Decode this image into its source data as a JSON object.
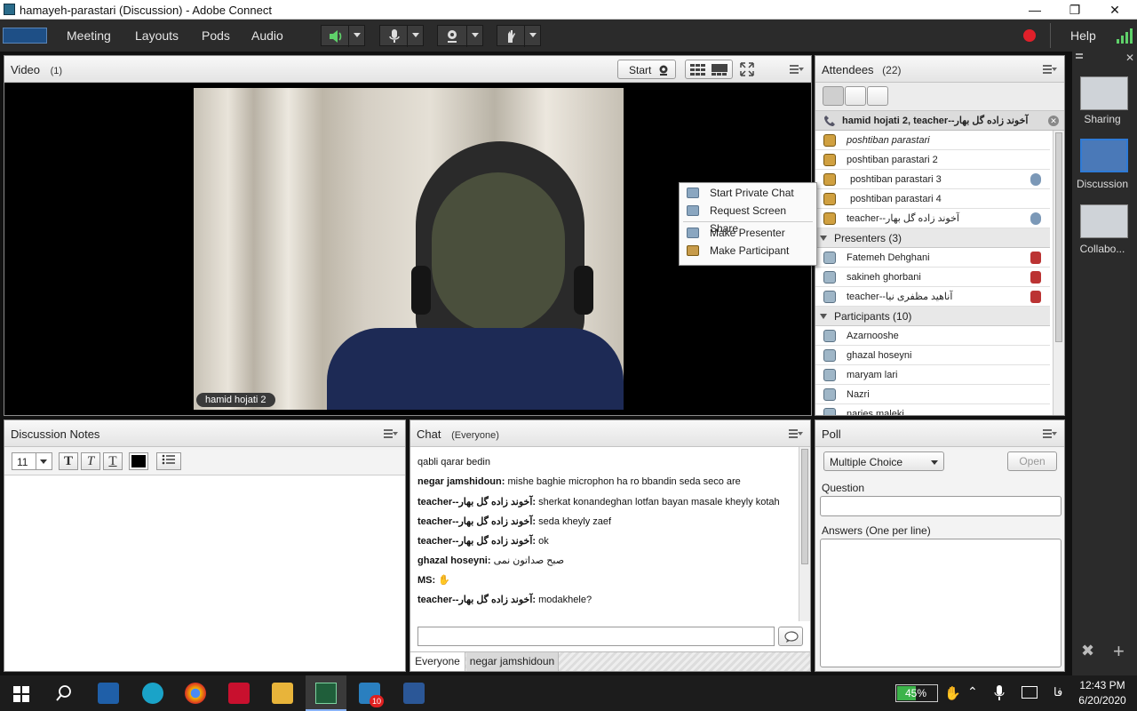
{
  "window": {
    "title": "hamayeh-parastari (Discussion) - Adobe Connect"
  },
  "menu": {
    "items": [
      "Meeting",
      "Layouts",
      "Pods",
      "Audio"
    ],
    "help": "Help"
  },
  "video_pod": {
    "title": "Video",
    "count": "(1)",
    "start_label": "Start",
    "name_tag": "hamid hojati 2"
  },
  "attendees": {
    "title": "Attendees",
    "count": "(22)",
    "selected": "hamid hojati 2, teacher--آخوند زاده گل بهار",
    "hosts": [
      {
        "name": "poshtiban parastari",
        "mic": false
      },
      {
        "name": "poshtiban parastari 2",
        "mic": false
      },
      {
        "name": "poshtiban parastari 3",
        "mic": true
      },
      {
        "name": "poshtiban parastari 4",
        "mic": false
      },
      {
        "name": "teacher--آخوند زاده گل بهار",
        "mic": true
      }
    ],
    "presenters_label": "Presenters (3)",
    "presenters": [
      {
        "name": "Fatemeh Dehghani"
      },
      {
        "name": "sakineh ghorbani"
      },
      {
        "name": "teacher--آناهید مظفری نیا"
      }
    ],
    "participants_label": "Participants (10)",
    "participants": [
      {
        "name": "Azarnooshe"
      },
      {
        "name": "ghazal hoseyni"
      },
      {
        "name": "maryam lari"
      },
      {
        "name": "Nazri"
      },
      {
        "name": "narjes maleki"
      }
    ]
  },
  "context_menu": {
    "items": [
      "Start Private Chat",
      "Request Screen Share",
      "Make Presenter",
      "Make Participant"
    ]
  },
  "notes_pod": {
    "title": "Discussion Notes",
    "font_size": "11",
    "text_color": "#000000"
  },
  "chat_pod": {
    "title": "Chat",
    "scope": "(Everyone)",
    "messages": [
      {
        "sender": "",
        "text": "qabli qarar bedin"
      },
      {
        "sender": "negar jamshidoun:",
        "text": "mishe baghie microphon ha ro bbandin seda seco are"
      },
      {
        "sender": "teacher--آخوند زاده گل بهار:",
        "text": "sherkat konandeghan lotfan bayan masale kheyly kotah"
      },
      {
        "sender": "teacher--آخوند زاده گل بهار:",
        "text": "seda kheyly zaef"
      },
      {
        "sender": "teacher--آخوند زاده گل بهار:",
        "text": "ok"
      },
      {
        "sender": "ghazal hoseyni:",
        "text": "صبح صداتون نمی"
      },
      {
        "sender": "MS:",
        "text": "✋"
      },
      {
        "sender": "teacher--آخوند زاده گل بهار:",
        "text": "modakhele?"
      }
    ],
    "input_placeholder": "",
    "tabs": [
      "Everyone",
      "negar jamshidoun"
    ]
  },
  "poll_pod": {
    "title": "Poll",
    "type": "Multiple Choice",
    "open_label": "Open",
    "question_label": "Question",
    "answers_label": "Answers (One per line)"
  },
  "layouts_panel": {
    "items": [
      "Sharing",
      "Discussion",
      "Collabo..."
    ]
  },
  "taskbar": {
    "battery": "45%",
    "lang": "فا",
    "time": "12:43 PM",
    "date": "6/20/2020",
    "badge": "10"
  },
  "colors": {
    "menubar": "#2b2b2b",
    "record": "#e0202a",
    "accent": "#2f7bd6"
  }
}
